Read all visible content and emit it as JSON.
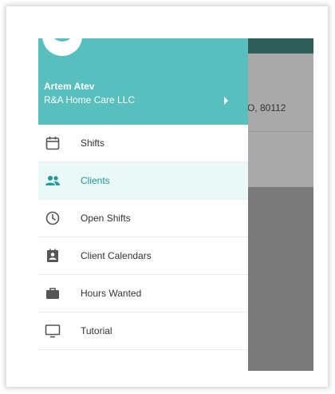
{
  "background": {
    "address_fragment": "O, 80112"
  },
  "drawer": {
    "user": {
      "name": "Artem Atev",
      "organization": "R&A Home Care LLC"
    },
    "items": [
      {
        "label": "Shifts",
        "icon": "calendar-icon",
        "selected": false
      },
      {
        "label": "Clients",
        "icon": "people-icon",
        "selected": true
      },
      {
        "label": "Open Shifts",
        "icon": "clock-icon",
        "selected": false
      },
      {
        "label": "Client Calendars",
        "icon": "contact-calendar-icon",
        "selected": false
      },
      {
        "label": "Hours Wanted",
        "icon": "briefcase-icon",
        "selected": false
      },
      {
        "label": "Tutorial",
        "icon": "monitor-icon",
        "selected": false
      }
    ]
  },
  "colors": {
    "header": "#58bfbe",
    "selected_text": "#1f9a98",
    "selected_bg": "#eaf8f7",
    "topbar": "#2f5d5a",
    "icon": "#555555"
  }
}
